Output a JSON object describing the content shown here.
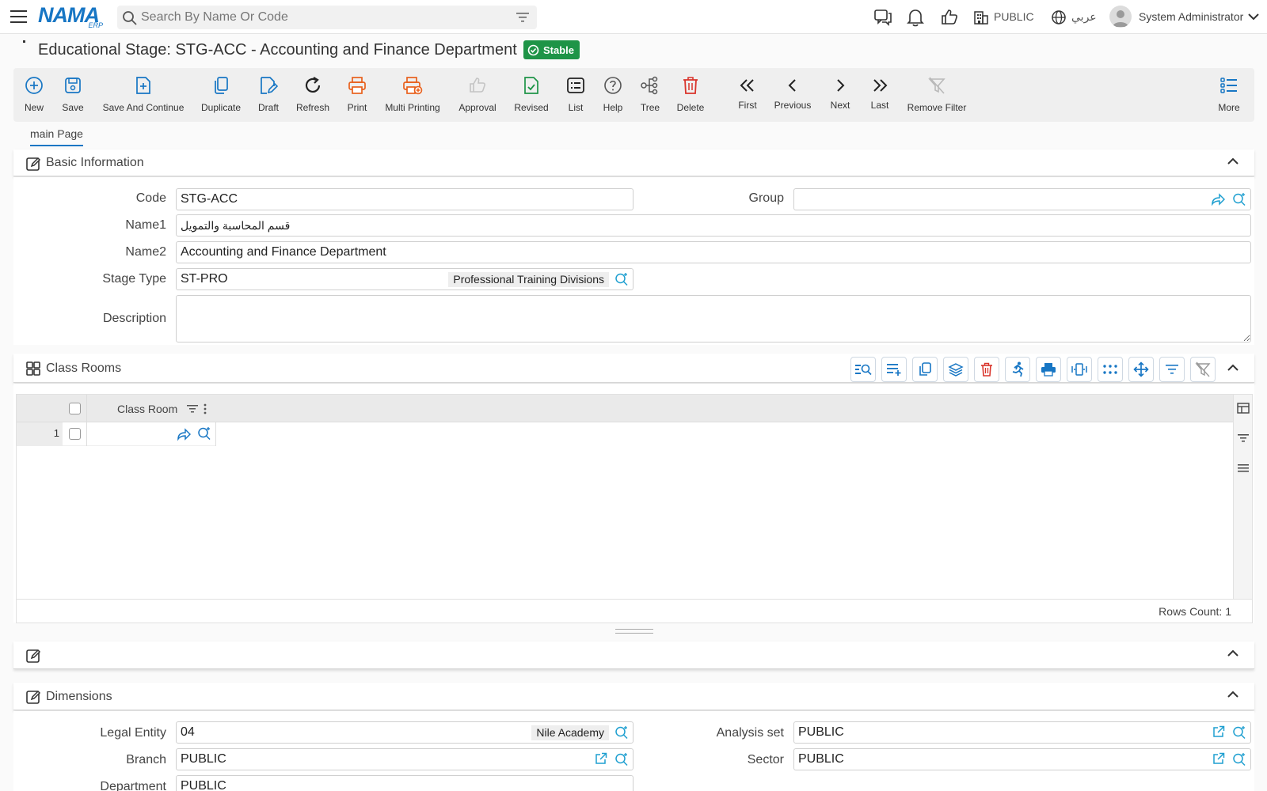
{
  "header": {
    "logo_text": "NAMA",
    "logo_sub": "ERP",
    "search_placeholder": "Search By Name Or Code",
    "company": "PUBLIC",
    "language": "عربي",
    "user": "System Administrator"
  },
  "page": {
    "title": "Educational Stage: STG-ACC - Accounting and Finance Department",
    "status": "Stable"
  },
  "toolbar": {
    "new": "New",
    "save": "Save",
    "save_continue": "Save And Continue",
    "duplicate": "Duplicate",
    "draft": "Draft",
    "refresh": "Refresh",
    "print": "Print",
    "multi_printing": "Multi Printing",
    "approval": "Approval",
    "revised": "Revised",
    "list": "List",
    "help": "Help",
    "tree": "Tree",
    "delete": "Delete",
    "first": "First",
    "previous": "Previous",
    "next": "Next",
    "last": "Last",
    "remove_filter": "Remove Filter",
    "more": "More"
  },
  "tabs": {
    "main": "main Page"
  },
  "basic": {
    "title": "Basic Information",
    "code_label": "Code",
    "code_value": "STG-ACC",
    "group_label": "Group",
    "group_value": "",
    "name1_label": "Name1",
    "name1_value": "قسم المحاسبة والتمويل",
    "name2_label": "Name2",
    "name2_value": "Accounting and Finance Department",
    "stage_type_label": "Stage Type",
    "stage_type_value": "ST-PRO",
    "stage_type_name": "Professional Training Divisions",
    "description_label": "Description",
    "description_value": ""
  },
  "class_rooms": {
    "title": "Class Rooms",
    "column": "Class Room",
    "row_number": "1",
    "rows_count": "Rows Count: 1"
  },
  "dimensions": {
    "title": "Dimensions",
    "legal_entity_label": "Legal Entity",
    "legal_entity_value": "04",
    "legal_entity_name": "Nile Academy",
    "analysis_set_label": "Analysis set",
    "analysis_set_value": "PUBLIC",
    "branch_label": "Branch",
    "branch_value": "PUBLIC",
    "sector_label": "Sector",
    "sector_value": "PUBLIC",
    "department_label": "Department",
    "department_value": "PUBLIC"
  },
  "colors": {
    "accent": "#1776c4",
    "success": "#1e9447",
    "orange": "#e8601c",
    "danger": "#d9342b"
  }
}
